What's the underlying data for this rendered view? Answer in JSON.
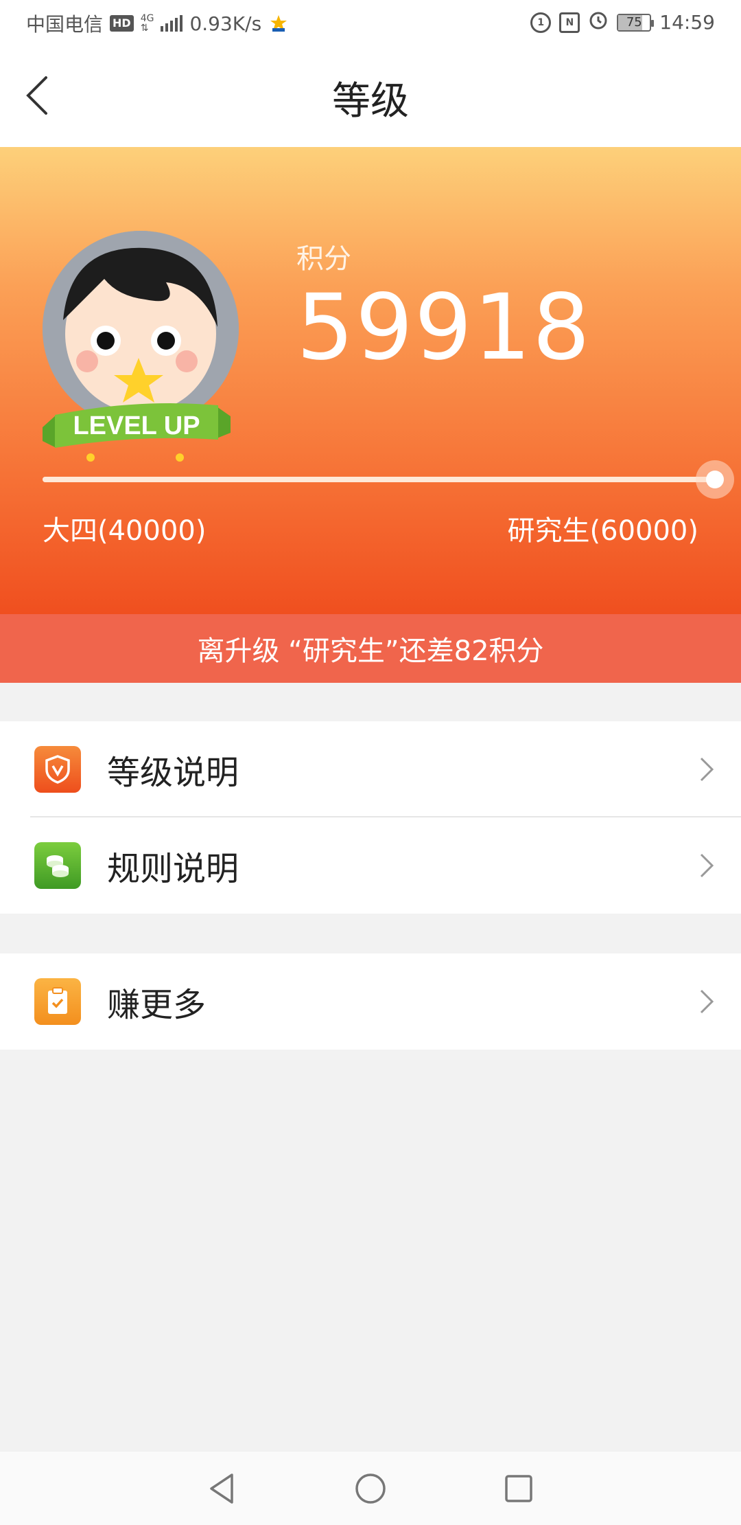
{
  "status_bar": {
    "carrier": "中国电信",
    "hd": "HD",
    "network": "4G",
    "speed": "0.93K/s",
    "battery": "75",
    "time": "14:59"
  },
  "header": {
    "title": "等级",
    "back_icon": "chevron-left-icon"
  },
  "profile": {
    "badge_text": "LEVEL UP",
    "score_label": "积分",
    "score_value": "59918",
    "progress_fraction": 0.9959,
    "level_current": "大四(40000)",
    "level_next": "研究生(60000)"
  },
  "banner": {
    "text": "离升级 “研究生”还差82积分"
  },
  "menu_sections": [
    {
      "items": [
        {
          "label": "等级说明",
          "icon": "shield-v-icon",
          "color": "#f15a24"
        },
        {
          "label": "规则说明",
          "icon": "coins-icon",
          "color": "#4caf2a"
        }
      ]
    },
    {
      "items": [
        {
          "label": "赚更多",
          "icon": "clipboard-check-icon",
          "color": "#f6a229"
        }
      ]
    }
  ],
  "nav": {
    "back": "triangle-back-icon",
    "home": "circle-home-icon",
    "recent": "square-recent-icon"
  },
  "colors": {
    "accent": "#f04f1f",
    "banner": "#f0654c"
  }
}
